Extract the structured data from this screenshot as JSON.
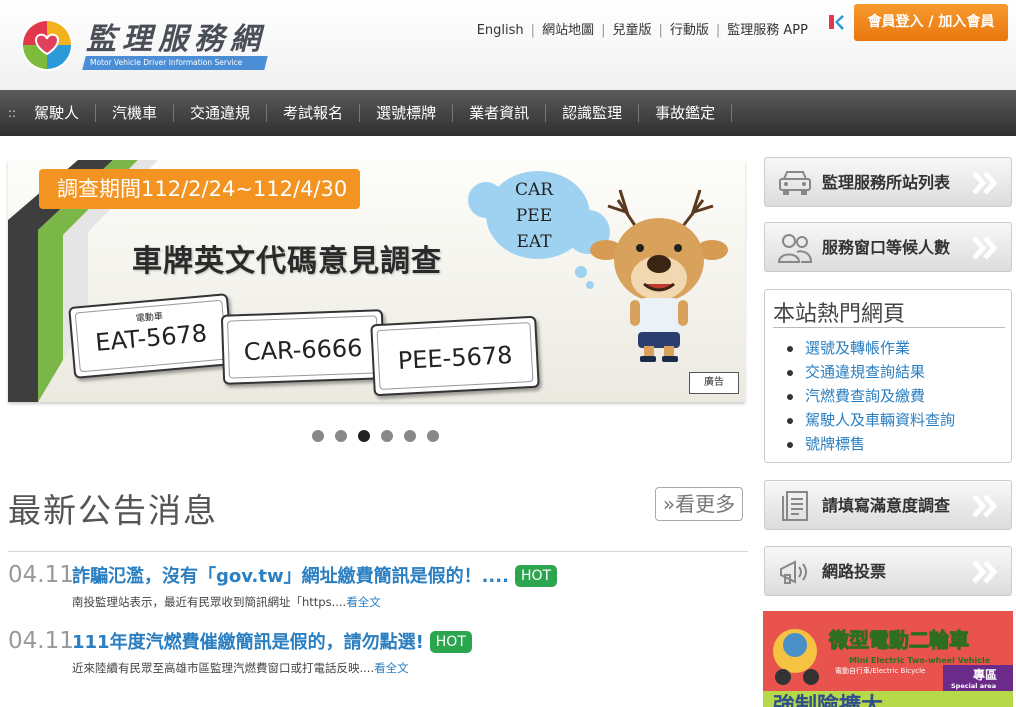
{
  "header": {
    "logo_title": "監理服務網",
    "logo_subtitle": "Motor Vehicle Driver Information Service",
    "top_links": [
      "English",
      "網站地圖",
      "兒童版",
      "行動版",
      "監理服務 APP"
    ],
    "login_label": "會員登入 / 加入會員"
  },
  "nav": {
    "items": [
      "駕駛人",
      "汽機車",
      "交通違規",
      "考試報名",
      "選號標牌",
      "業者資訊",
      "認識監理",
      "事故鑑定"
    ]
  },
  "banner": {
    "survey_period": "調查期間112/2/24~112/4/30",
    "title": "車牌英文代碼意見調查",
    "plates": [
      {
        "caption": "電動車",
        "number": "EAT-5678"
      },
      {
        "caption": "",
        "number": "CAR-6666"
      },
      {
        "caption": "",
        "number": "PEE-5678"
      }
    ],
    "cloud_words": [
      "CAR",
      "PEE",
      "EAT"
    ],
    "ad_label": "廣告",
    "slide_count": 6,
    "active_slide": 3
  },
  "news": {
    "title": "最新公告消息",
    "more_label": "»看更多",
    "items": [
      {
        "date": "04.11",
        "headline": "詐騙氾濫，沒有「gov.tw」網址繳費簡訊是假的！....",
        "badge": "HOT",
        "summary": "南投監理站表示，最近有民眾收到簡訊網址「https....",
        "read_more": "看全文"
      },
      {
        "date": "04.11",
        "headline": "111年度汽燃費催繳簡訊是假的，請勿點選!",
        "badge": "HOT",
        "summary": "近來陸續有民眾至高雄市區監理汽燃費窗口或打電話反映....",
        "read_more": "看全文"
      }
    ]
  },
  "sidebar": {
    "buttons": [
      "監理服務所站列表",
      "服務窗口等候人數",
      "請填寫滿意度調查",
      "網路投票"
    ],
    "hot_pages_title": "本站熱門網頁",
    "hot_pages": [
      "選號及轉帳作業",
      "交通違規查詢結果",
      "汽燃費查詢及繳費",
      "駕駛人及車輛資料查詢",
      "號牌標售"
    ],
    "promo_title": "微型電動二輪車",
    "promo_en": "Mini Electric Two-wheel Vehicle",
    "promo_sub": "電動自行車/Electric Bicycle",
    "promo_zone": "專區",
    "promo_zone_en": "Special area",
    "promo_bottom": "強制險擴大"
  },
  "colors": {
    "accent_orange": "#f08a1e",
    "link_blue": "#2b7fc1",
    "hot_green": "#2ca54f",
    "nav_dark": "#3a3a3a"
  }
}
